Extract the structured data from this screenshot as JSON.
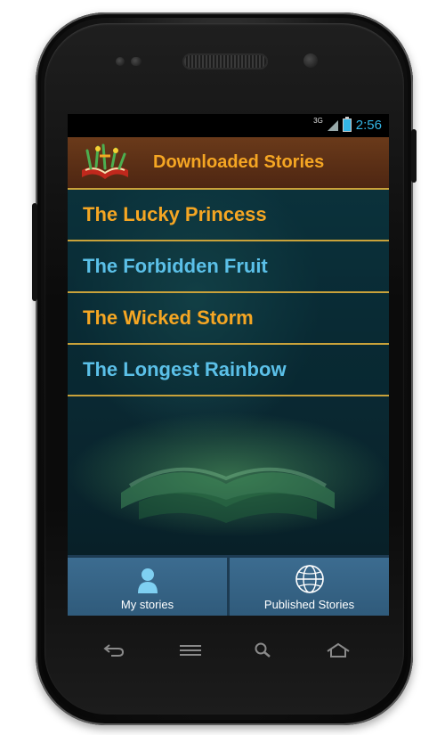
{
  "status_bar": {
    "network": "3G",
    "time": "2:56"
  },
  "header": {
    "title": "Downloaded Stories",
    "logo_icon": "book-logo-icon"
  },
  "stories": [
    {
      "title": "The Lucky Princess",
      "color": "#f5a623"
    },
    {
      "title": "The Forbidden Fruit",
      "color": "#5bc0e8"
    },
    {
      "title": "The Wicked Storm",
      "color": "#f5a623"
    },
    {
      "title": "The Longest Rainbow",
      "color": "#5bc0e8"
    }
  ],
  "tabs": [
    {
      "label": "My stories",
      "icon": "person-icon"
    },
    {
      "label": "Published Stories",
      "icon": "globe-icon"
    }
  ],
  "nav": [
    "back-icon",
    "menu-icon",
    "search-icon",
    "home-icon"
  ],
  "colors": {
    "accent_orange": "#f5a623",
    "accent_blue": "#5bc0e8",
    "header_brown": "#5a2e16",
    "tabbar_blue": "#2f5a7a",
    "divider_gold": "#c9a23a"
  }
}
